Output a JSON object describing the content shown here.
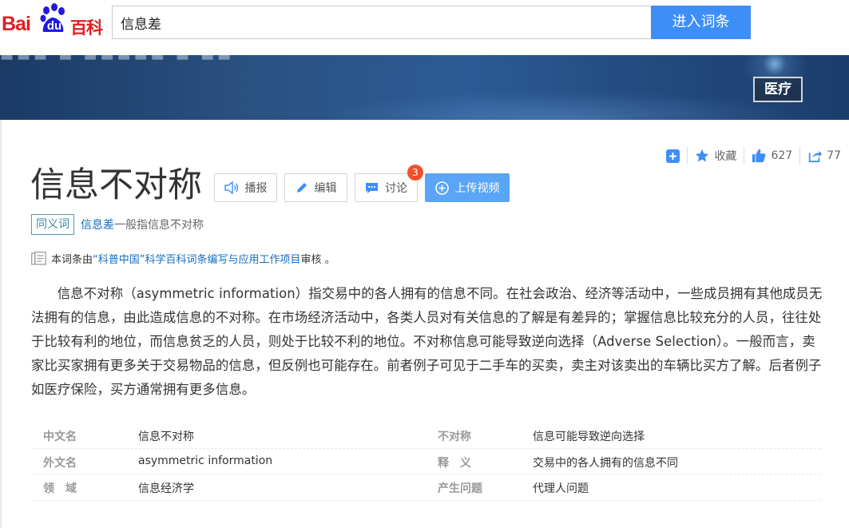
{
  "header": {
    "logo": {
      "part1": "Bai",
      "part2": "du",
      "part3": "百科"
    },
    "search_value": "信息差",
    "search_button": "进入词条"
  },
  "banner": {
    "category_tag": "医疗"
  },
  "actions": {
    "add_icon": "plus-square-icon",
    "favorite_label": "收藏",
    "like_count": "627",
    "share_count": "77"
  },
  "entry": {
    "title": "信息不对称",
    "buttons": {
      "play": "播报",
      "edit": "编辑",
      "discuss": "讨论",
      "discuss_badge": "3",
      "upload_video": "上传视频"
    },
    "synonym": {
      "tag": "同义词",
      "link": "信息差",
      "text": "一般指信息不对称"
    },
    "review": {
      "prefix": "本词条由",
      "link": "“科普中国”科学百科词条编写与应用工作项目",
      "suffix": " 审核 。"
    },
    "paragraph": "信息不对称（asymmetric information）指交易中的各人拥有的信息不同。在社会政治、经济等活动中，一些成员拥有其他成员无法拥有的信息，由此造成信息的不对称。在市场经济活动中，各类人员对有关信息的了解是有差异的；掌握信息比较充分的人员，往往处于比较有利的地位，而信息贫乏的人员，则处于比较不利的地位。不对称信息可能导致逆向选择（Adverse Selection）。一般而言，卖家比买家拥有更多关于交易物品的信息，但反例也可能存在。前者例子可见于二手车的买卖，卖主对该卖出的车辆比买方了解。后者例子如医疗保险，买方通常拥有更多信息。"
  },
  "info_table": [
    {
      "k1": "中文名",
      "v1": "信息不对称",
      "k2": "不对称",
      "v2": "信息可能导致逆向选择"
    },
    {
      "k1": "外文名",
      "v1": "asymmetric information",
      "k2": "释　义",
      "v2": "交易中的各人拥有的信息不同"
    },
    {
      "k1": "领　域",
      "v1": "信息经济学",
      "k2": "产生问题",
      "v2": "代理人问题"
    }
  ],
  "colors": {
    "brand_red": "#de1f26",
    "search_blue": "#3e8ef7",
    "link_blue": "#136ec2",
    "upload_blue": "#5aa5f5",
    "badge_red": "#f0512c"
  }
}
